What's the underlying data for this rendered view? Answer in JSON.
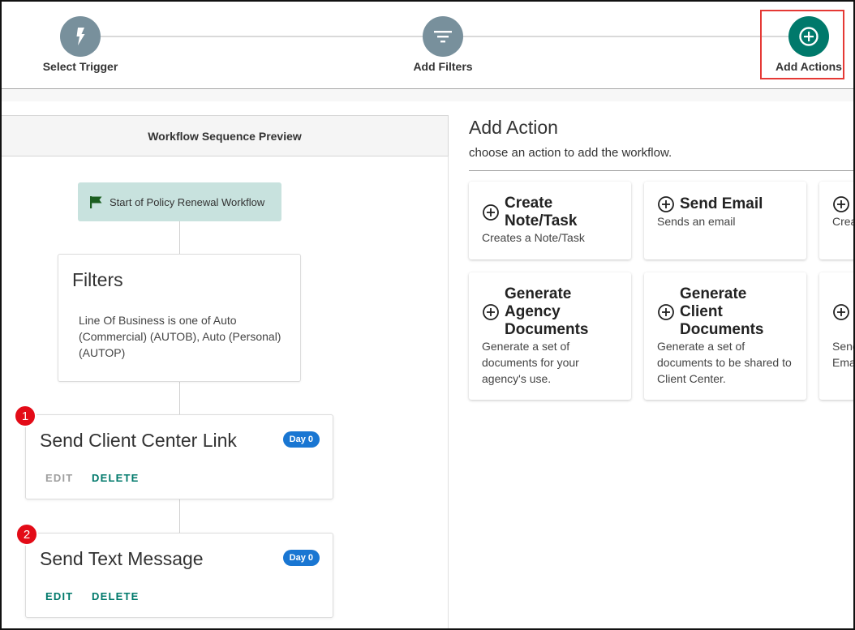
{
  "stepper": {
    "steps": [
      {
        "label": "Select Trigger",
        "icon": "lightning-icon"
      },
      {
        "label": "Add Filters",
        "icon": "filter-icon"
      },
      {
        "label": "Add Actions",
        "icon": "add-circle-icon"
      }
    ],
    "active_step": 2,
    "colors": {
      "inactive": "#78909c",
      "active": "#00796b",
      "highlight": "#e53935"
    }
  },
  "preview": {
    "header": "Workflow Sequence Preview",
    "start_node": "Start of Policy Renewal Workflow",
    "filters": {
      "title": "Filters",
      "text": "Line Of Business is one of Auto (Commercial) (AUTOB), Auto (Personal) (AUTOP)"
    },
    "actions": [
      {
        "number": "1",
        "title": "Send Client Center Link",
        "day": "Day 0",
        "edit": "EDIT",
        "delete": "DELETE",
        "edit_disabled": true
      },
      {
        "number": "2",
        "title": "Send Text Message",
        "day": "Day 0",
        "edit": "EDIT",
        "delete": "DELETE",
        "edit_disabled": false
      }
    ]
  },
  "add_action": {
    "title": "Add Action",
    "subtitle": "choose an action to add the workflow.",
    "options": [
      {
        "title": "Create Note/Task",
        "desc": "Creates a Note/Task"
      },
      {
        "title": "Send Email",
        "desc": "Sends an email"
      },
      {
        "title": "",
        "desc": "Crea"
      },
      {
        "title": "Generate Agency Documents",
        "desc": "Generate a set of documents for your agency's use."
      },
      {
        "title": "Generate Client Documents",
        "desc": "Generate a set of documents to be shared to Client Center."
      },
      {
        "title": "",
        "desc": "Send Ema"
      }
    ]
  },
  "colors": {
    "accent": "#00796b",
    "badge_blue": "#1976d2",
    "number_red": "#e30b17",
    "start_node_bg": "#c8e2de"
  }
}
